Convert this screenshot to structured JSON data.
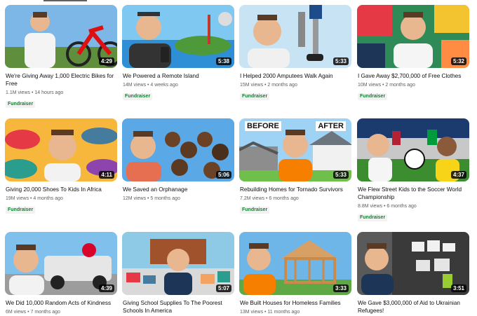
{
  "videos": [
    {
      "title": "We're Giving Away 1,000 Electric Bikes for Free",
      "duration": "4:29",
      "views": "1.1M views",
      "age": "14 hours ago",
      "badge": "Fundraiser"
    },
    {
      "title": "We Powered a Remote Island",
      "duration": "5:38",
      "views": "14M views",
      "age": "4 weeks ago",
      "badge": "Fundraiser"
    },
    {
      "title": "I Helped 2000 Amputees Walk Again",
      "duration": "5:33",
      "views": "15M views",
      "age": "2 months ago",
      "badge": "Fundraiser"
    },
    {
      "title": "I Gave Away $2,700,000 of Free Clothes",
      "duration": "5:32",
      "views": "10M views",
      "age": "2 months ago",
      "badge": "Fundraiser"
    },
    {
      "title": "Giving 20,000 Shoes To Kids In Africa",
      "duration": "4:11",
      "views": "19M views",
      "age": "4 months ago",
      "badge": "Fundraiser"
    },
    {
      "title": "We Saved an Orphanage",
      "duration": "5:06",
      "views": "12M views",
      "age": "5 months ago",
      "badge": ""
    },
    {
      "title": "Rebuilding Homes for Tornado Survivors",
      "duration": "5:33",
      "views": "7.2M views",
      "age": "6 months ago",
      "badge": "Fundraiser"
    },
    {
      "title": "We Flew Street Kids to the Soccer World Championship",
      "duration": "4:37",
      "views": "8.8M views",
      "age": "6 months ago",
      "badge": "Fundraiser"
    },
    {
      "title": "We Did 10,000 Random Acts of Kindness",
      "duration": "4:39",
      "views": "6M views",
      "age": "7 months ago",
      "badge": ""
    },
    {
      "title": "Giving School Supplies To The Poorest Schools In America",
      "duration": "5:07",
      "views": "",
      "age": "",
      "badge": ""
    },
    {
      "title": "We Built Houses for Homeless Families",
      "duration": "3:33",
      "views": "13M views",
      "age": "11 months ago",
      "badge": ""
    },
    {
      "title": "We Gave $3,000,000 of Aid to Ukrainian Refugees!",
      "duration": "3:51",
      "views": "",
      "age": "",
      "badge": ""
    }
  ],
  "thumb_text": {
    "before": "BEFORE",
    "after": "AFTER"
  },
  "colors": {
    "badge_text": "#1a7f37",
    "meta_text": "#606060"
  }
}
